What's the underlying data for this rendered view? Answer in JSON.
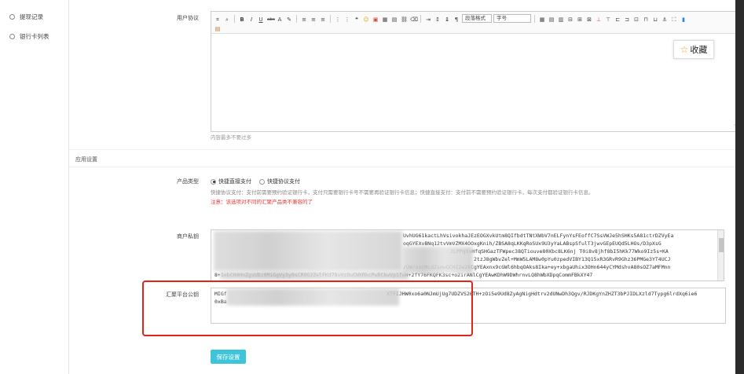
{
  "sidebar": {
    "items": [
      {
        "label": "提现记录"
      },
      {
        "label": "银行卡列表"
      }
    ]
  },
  "form": {
    "agreement_label": "用户协议",
    "editor": {
      "paragraph_format": "段落格式",
      "font_size": "字号",
      "favorite_label": "收藏",
      "footer_counter": "字",
      "hint": "内容最多不要过多"
    },
    "section_title": "应用设置",
    "product_type": {
      "label": "产品类型",
      "options": [
        "快捷直接支付",
        "快捷协议支付"
      ],
      "selected": "快捷直接支付",
      "description": "快捷协议支付：支付前需要预约验证银行卡，支付只需要银行卡号不需要再验证银行卡信息；快捷直接支付：支付前不需要预约验证银行卡，每次支付都验证银行卡信息。",
      "warning": "注意：该选项对不同的汇聚产品类不兼容的了"
    },
    "merchant_key": {
      "label": "商户私钥",
      "lines": [
        "UvhUG61kactLhVsivokhaJEzEOGXvkUtm8QIfbdtTNtXWbV7nELFynYsFEoffC7SsVWJe5hSHKs5A81ctrDZVyEa",
        "oqGYEXvBNq12tvVmVZMX4OOxgKnih/ZBSA8qLKKqRoSUx9U3yYaLABspSfulT3jwvGEpEUQd5LHOs/D3pXsG",
        "2LPPqVuHfqSHGazTFWpec38QTiouve80Xbc8LK6nj T0i8v8jhf8bI5hKk77Wko9Iz5s+KA",
        "2tzJ8gWbvZel+MmW5LAM8w0pYu0zpedVIBY13Q15xR3GRvR9Ghz36PMGe3YT4UCJ",
        "/UW/sncMcdZsmwQCHZ2e2kCgYEAxnx9cGWl6hbqOAks8Ika+ey+xbgaUhix3OHn644yCYMdshvA80sOZ7aMFMnn",
        "8+1ebCH4HnZgsUDz0MiGgVy3y0sCR9G2ZelFKd78vVzOuCWXRkcPwBCkwVp1fwW+2fY76FKQFK3sc+o2irANlCgYEAwKDhW9DWhrnvLQ8hWbXDpqCommFBkXY47"
      ]
    },
    "platform_key": {
      "label": "汇聚平台公钥",
      "lines": [
        "MIGf                                                    XTFIJHW0xo6a0NJmUjUg7UDZVS26TH+zOi5e9Ud8ZyAgNigHdtrv2dUNwDh3Qgv/RJDKgYnZHZT3bPJIDLXzld7Typg6lrdXq6ie6",
        "0xBa"
      ]
    },
    "save_label": "保存设置"
  },
  "colors": {
    "accent": "#3ec5d9",
    "highlight_border": "#e0241b",
    "warning_text": "#e53935"
  }
}
